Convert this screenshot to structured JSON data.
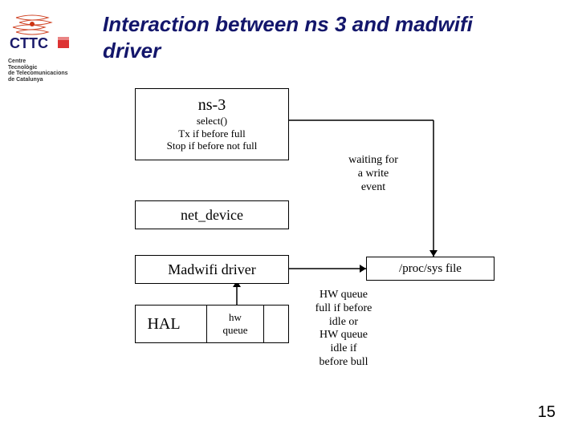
{
  "logo": {
    "name": "CTTC",
    "sub1": "Centre",
    "sub2": "Tecnològic",
    "sub3": "de Telecomunicacions",
    "sub4": "de Catalunya"
  },
  "title": "Interaction between ns 3 and madwifi driver",
  "boxes": {
    "ns3": {
      "title": "ns-3",
      "l1": "select()",
      "l2": "Tx if before full",
      "l3": "Stop if before not full"
    },
    "netdev": {
      "title": "net_device"
    },
    "madwifi": {
      "title": "Madwifi driver"
    },
    "hal": {
      "title": "HAL",
      "q1": "hw",
      "q2": "queue"
    },
    "proc": {
      "title": "/proc/sys file"
    }
  },
  "labels": {
    "wait": {
      "l1": "waiting for",
      "l2": "a write",
      "l3": "event"
    },
    "hw": {
      "l1": "HW queue",
      "l2": "full if before",
      "l3": "idle or",
      "l4": "HW queue",
      "l5": "idle if",
      "l6": "before bull"
    }
  },
  "pagenum": "15"
}
